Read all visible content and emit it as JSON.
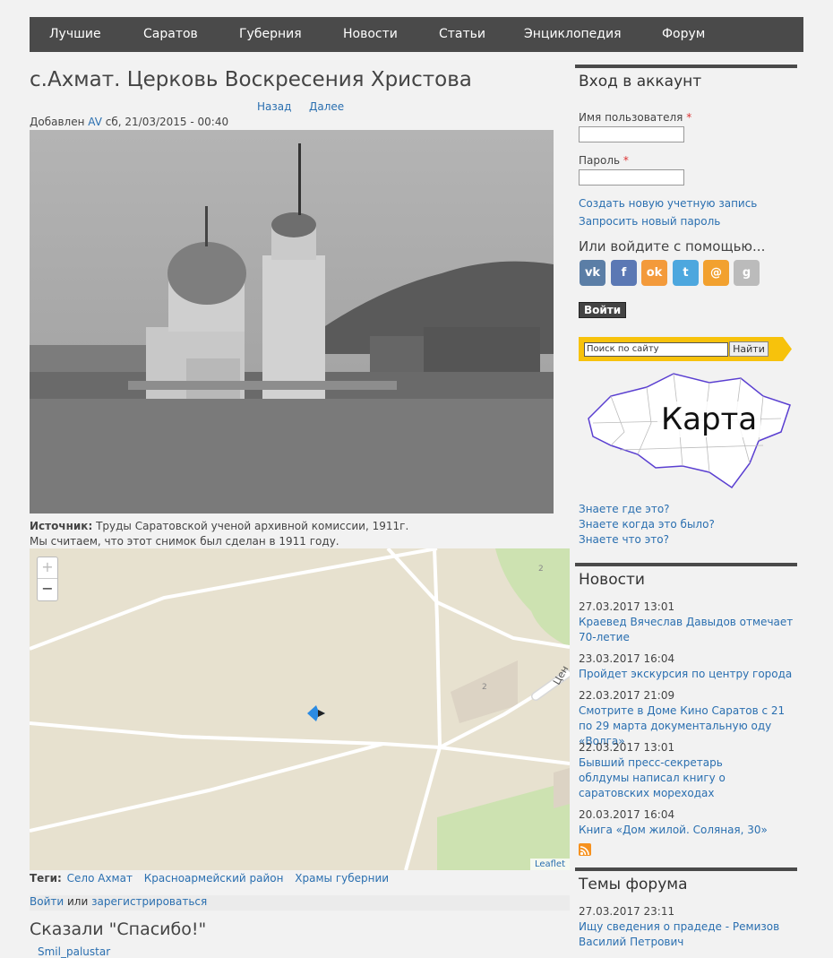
{
  "nav": [
    "Лучшие",
    "Саратов",
    "Губерния",
    "Новости",
    "Статьи",
    "Энциклопедия",
    "Форум"
  ],
  "article": {
    "title": "с.Ахмат. Церковь Воскресения Христова",
    "back": "Назад",
    "next": "Далее",
    "added_prefix": "Добавлен",
    "author": "AV",
    "added_date": "сб, 21/03/2015 - 00:40",
    "source_label": "Источник:",
    "source_text": "Труды Саратовской ученой архивной комиссии, 1911г.",
    "dating_note": "Мы считаем, что этот снимок был сделан в 1911 году."
  },
  "map": {
    "zoom_in": "+",
    "zoom_out": "−",
    "attribution": "Leaflet",
    "street_label": "Цен",
    "building_label_1": "2",
    "building_label_2": "2"
  },
  "tags": {
    "label": "Теги:",
    "items": [
      "Село Ахмат",
      "Красноармейский район",
      "Храмы губернии"
    ]
  },
  "login_line": {
    "login": "Войти",
    "or": "или",
    "register": "зарегистрироваться"
  },
  "thanks": {
    "title": "Сказали \"Спасибо!\"",
    "user": "Smil_palustar"
  },
  "sidebar": {
    "login_title": "Вход в аккаунт",
    "username_label": "Имя пользователя",
    "password_label": "Пароль",
    "required_mark": "*",
    "create_account": "Создать новую учетную запись",
    "request_password": "Запросить новый пароль",
    "or_login_with": "Или войдите с помощью...",
    "social": [
      {
        "name": "vk",
        "glyph": "vk",
        "color": "#5b7ea6"
      },
      {
        "name": "facebook",
        "glyph": "f",
        "color": "#5b78b4"
      },
      {
        "name": "odnoklassniki",
        "glyph": "ok",
        "color": "#f39a3b"
      },
      {
        "name": "twitter",
        "glyph": "t",
        "color": "#4da7de"
      },
      {
        "name": "mailru",
        "glyph": "@",
        "color": "#f2a12f"
      },
      {
        "name": "google",
        "glyph": "g",
        "color": "#bbbbbb"
      }
    ],
    "login_button": "Войти",
    "search_placeholder": "Поиск по сайту",
    "search_button": "Найти",
    "map_label": "Карта",
    "quiz_links": [
      "Знаете где это?",
      "Знаете когда это было?",
      "Знаете что это?"
    ],
    "news_title": "Новости",
    "news": [
      {
        "date": "27.03.2017 13:01",
        "title": "Краевед Вячеслав Давыдов отмечает 70-летие"
      },
      {
        "date": "23.03.2017 16:04",
        "title": "Пройдет экскурсия по центру города"
      },
      {
        "date": "22.03.2017 21:09",
        "title": "Смотрите в Доме Кино Саратов с 21 по 29 марта документальную оду «Волга»"
      },
      {
        "date": "22.03.2017 13:01",
        "title": "Бывший пресс-секретарь облдумы написал книгу о саратовских мореходах"
      },
      {
        "date": "20.03.2017 16:04",
        "title": "Книга «Дом жилой. Соляная, 30»"
      }
    ],
    "forum_title": "Темы форума",
    "forum": [
      {
        "date": "27.03.2017 23:11",
        "title": "Ищу сведения о прадеде - Ремизов Василий Петрович"
      }
    ]
  }
}
